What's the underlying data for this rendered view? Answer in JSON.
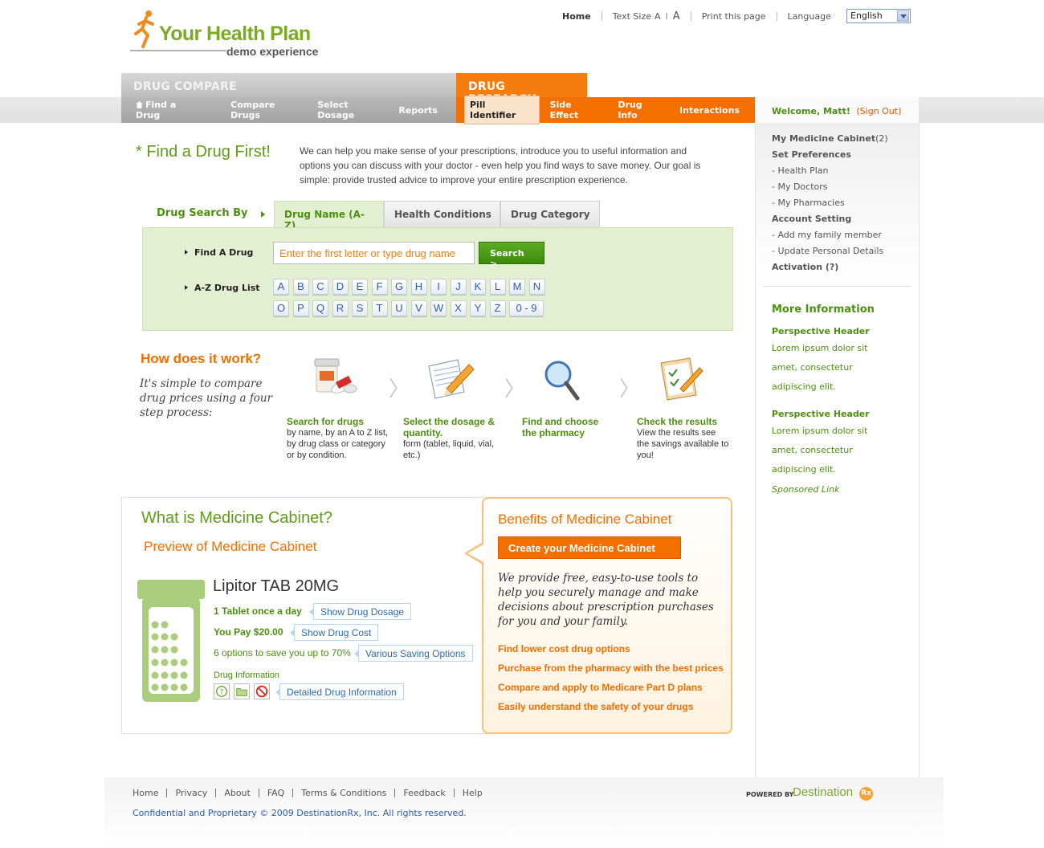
{
  "brand": {
    "name": "Your Health Plan",
    "tagline": "demo experience"
  },
  "toplinks": {
    "home": "Home",
    "text_size": "Text Size",
    "size_small": "A",
    "size_divider": "I",
    "size_large": "A",
    "print": "Print this page",
    "language_label": "Language",
    "language_value": "English"
  },
  "nav": {
    "compare_tab": "DRUG COMPARE",
    "research_tab": "DRUG RESEARCH",
    "compare_items": [
      "Find a Drug",
      "Compare Drugs",
      "Select Dosage",
      "Reports"
    ],
    "research_items": [
      "Pill Identifier",
      "Side Effect",
      "Drug Info",
      "Interactions"
    ]
  },
  "sidebar": {
    "welcome": "Welcome, Matt!",
    "signout": "(Sign Out)",
    "links": [
      {
        "label": "My Medicine Cabinet",
        "count": "(2)",
        "header": true
      },
      {
        "label": "Set Preferences",
        "header": true
      },
      {
        "label": "- Health Plan"
      },
      {
        "label": "- My Doctors"
      },
      {
        "label": "- My Pharmacies"
      },
      {
        "label": "Account Setting",
        "header": true
      },
      {
        "label": "- Add my family member"
      },
      {
        "label": "- Update Personal Details"
      },
      {
        "label": "Activation (?)",
        "header": true
      }
    ],
    "more_info_title": "More Information",
    "info_blocks": [
      {
        "header": "Perspective Header",
        "lines": [
          "Lorem ipsum dolor sit",
          "amet, consectetur",
          "adipiscing elit."
        ]
      },
      {
        "header": "Perspective Header",
        "lines": [
          "Lorem ipsum dolor sit",
          "amet, consectetur",
          "adipiscing elit."
        ]
      }
    ],
    "sponsored": "Sponsored Link"
  },
  "find": {
    "title": "* Find a Drug First!",
    "intro": "We can help you make sense of your prescriptions, introduce you to useful information and options you can discuss with your doctor - even help you find ways to save money. Our goal is simple: provide trusted advice to improve your entire prescription experience.",
    "search_by": "Drug Search By",
    "tabs": [
      "Drug Name (A-Z)",
      "Health Conditions",
      "Drug Category"
    ],
    "find_label": "Find A Drug",
    "input_placeholder": "Enter the first letter or type drug name",
    "search_button": "Search >",
    "az_label": "A-Z Drug List",
    "letters_row1": [
      "A",
      "B",
      "C",
      "D",
      "E",
      "F",
      "G",
      "H",
      "I",
      "J",
      "K",
      "L",
      "M",
      "N"
    ],
    "letters_row2": [
      "O",
      "P",
      "Q",
      "R",
      "S",
      "T",
      "U",
      "V",
      "W",
      "X",
      "Y",
      "Z",
      "0 - 9"
    ]
  },
  "how": {
    "title": "How does it work?",
    "subtitle": "It's simple to compare drug prices using a four step process:",
    "steps": [
      {
        "title": "Search for drugs",
        "desc": "by name, by an A to Z list, by drug class or category or by condition.",
        "icon": "pill-bottle-icon"
      },
      {
        "title": "Select the dosage & quantity.",
        "desc": "form (tablet, liquid, vial, etc.)",
        "icon": "notepad-pencil-icon"
      },
      {
        "title": "Find and choose the pharmacy",
        "desc": "",
        "icon": "magnifier-icon"
      },
      {
        "title": "Check the results",
        "desc": "View the results see the savings available to you!",
        "icon": "clipboard-check-icon"
      }
    ]
  },
  "cabinet": {
    "title": "What is Medicine Cabinet?",
    "preview_title": "Preview of Medicine Cabinet",
    "drug_name": "Lipitor TAB 20MG",
    "dosage_text": "1 Tablet once a day",
    "dosage_tag": "Show Drug Dosage",
    "pay_text": "You Pay $20.00",
    "pay_tag": "Show Drug Cost",
    "options_text": "6 options to save you up to 70%",
    "options_tag": "Various Saving Options",
    "info_label": "Drug Information",
    "info_tag": "Detailed Drug Information"
  },
  "benefits": {
    "title": "Benefits of Medicine Cabinet",
    "button": "Create your Medicine Cabinet",
    "text": "We provide free, easy-to-use tools to help you securely manage and make decisions about prescription purchases for you and your family.",
    "items": [
      "Find lower cost drug options",
      "Purchase from the pharmacy with the best prices",
      "Compare and apply to Medicare Part D plans",
      "Easily understand the safety of your drugs"
    ]
  },
  "footer": {
    "links": [
      "Home",
      "Privacy",
      "About",
      "FAQ",
      "Terms & Conditions",
      "Feedback",
      "Help"
    ],
    "copyright": "Confidential and Proprietary © 2009 DestinationRx, Inc. All rights reserved.",
    "powered_by": "POWERED BY",
    "partner": "Destination",
    "partner_badge": "Rx"
  },
  "colors": {
    "brand_green": "#7aab22",
    "accent_orange": "#f26f00",
    "link_blue": "#2a5db0"
  }
}
